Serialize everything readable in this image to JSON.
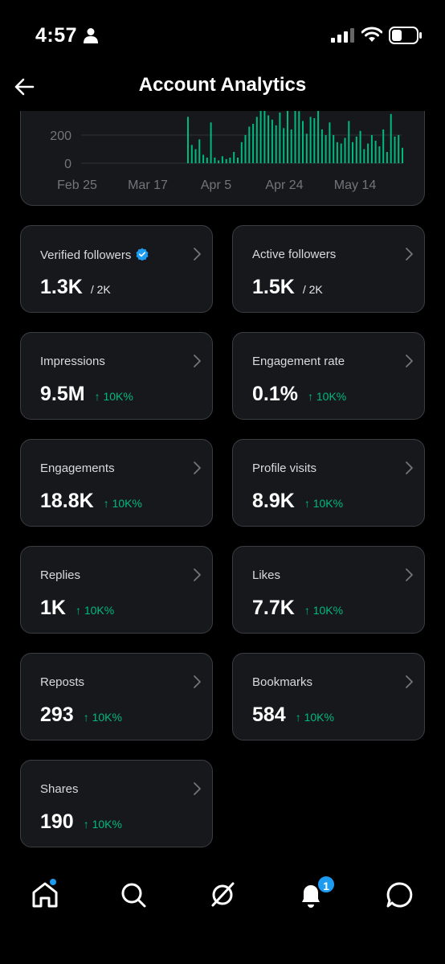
{
  "status_bar": {
    "time": "4:57"
  },
  "header": {
    "title": "Account Analytics"
  },
  "chart_data": {
    "type": "bar",
    "y_ticks": [
      "200",
      "0"
    ],
    "x_ticks": [
      "Feb 25",
      "Mar 17",
      "Apr 5",
      "Apr 24",
      "May 14"
    ],
    "color": "#00ba7c",
    "values": [
      330,
      130,
      100,
      170,
      60,
      40,
      290,
      40,
      20,
      50,
      30,
      40,
      80,
      40,
      150,
      200,
      260,
      280,
      330,
      380,
      400,
      340,
      310,
      270,
      360,
      250,
      380,
      240,
      400,
      370,
      300,
      210,
      330,
      320,
      380,
      240,
      200,
      290,
      200,
      150,
      140,
      180,
      300,
      150,
      190,
      230,
      100,
      140,
      200,
      160,
      120,
      240,
      80,
      350,
      190,
      200,
      110
    ]
  },
  "cards": [
    {
      "label": "Verified followers",
      "value": "1.3K",
      "sub": "/ 2K",
      "change": "",
      "verified": true
    },
    {
      "label": "Active followers",
      "value": "1.5K",
      "sub": "/ 2K",
      "change": ""
    },
    {
      "label": "Impressions",
      "value": "9.5M",
      "sub": "",
      "change": "↑ 10K%"
    },
    {
      "label": "Engagement rate",
      "value": "0.1%",
      "sub": "",
      "change": "↑ 10K%"
    },
    {
      "label": "Engagements",
      "value": "18.8K",
      "sub": "",
      "change": "↑ 10K%"
    },
    {
      "label": "Profile visits",
      "value": "8.9K",
      "sub": "",
      "change": "↑ 10K%"
    },
    {
      "label": "Replies",
      "value": "1K",
      "sub": "",
      "change": "↑ 10K%"
    },
    {
      "label": "Likes",
      "value": "7.7K",
      "sub": "",
      "change": "↑ 10K%"
    },
    {
      "label": "Reposts",
      "value": "293",
      "sub": "",
      "change": "↑ 10K%"
    },
    {
      "label": "Bookmarks",
      "value": "584",
      "sub": "",
      "change": "↑ 10K%"
    },
    {
      "label": "Shares",
      "value": "190",
      "sub": "",
      "change": "↑ 10K%"
    }
  ],
  "bottom_nav": {
    "items": [
      "home-icon",
      "search-icon",
      "grok-icon",
      "notifications-icon",
      "messages-icon"
    ],
    "notification_count": "1"
  }
}
